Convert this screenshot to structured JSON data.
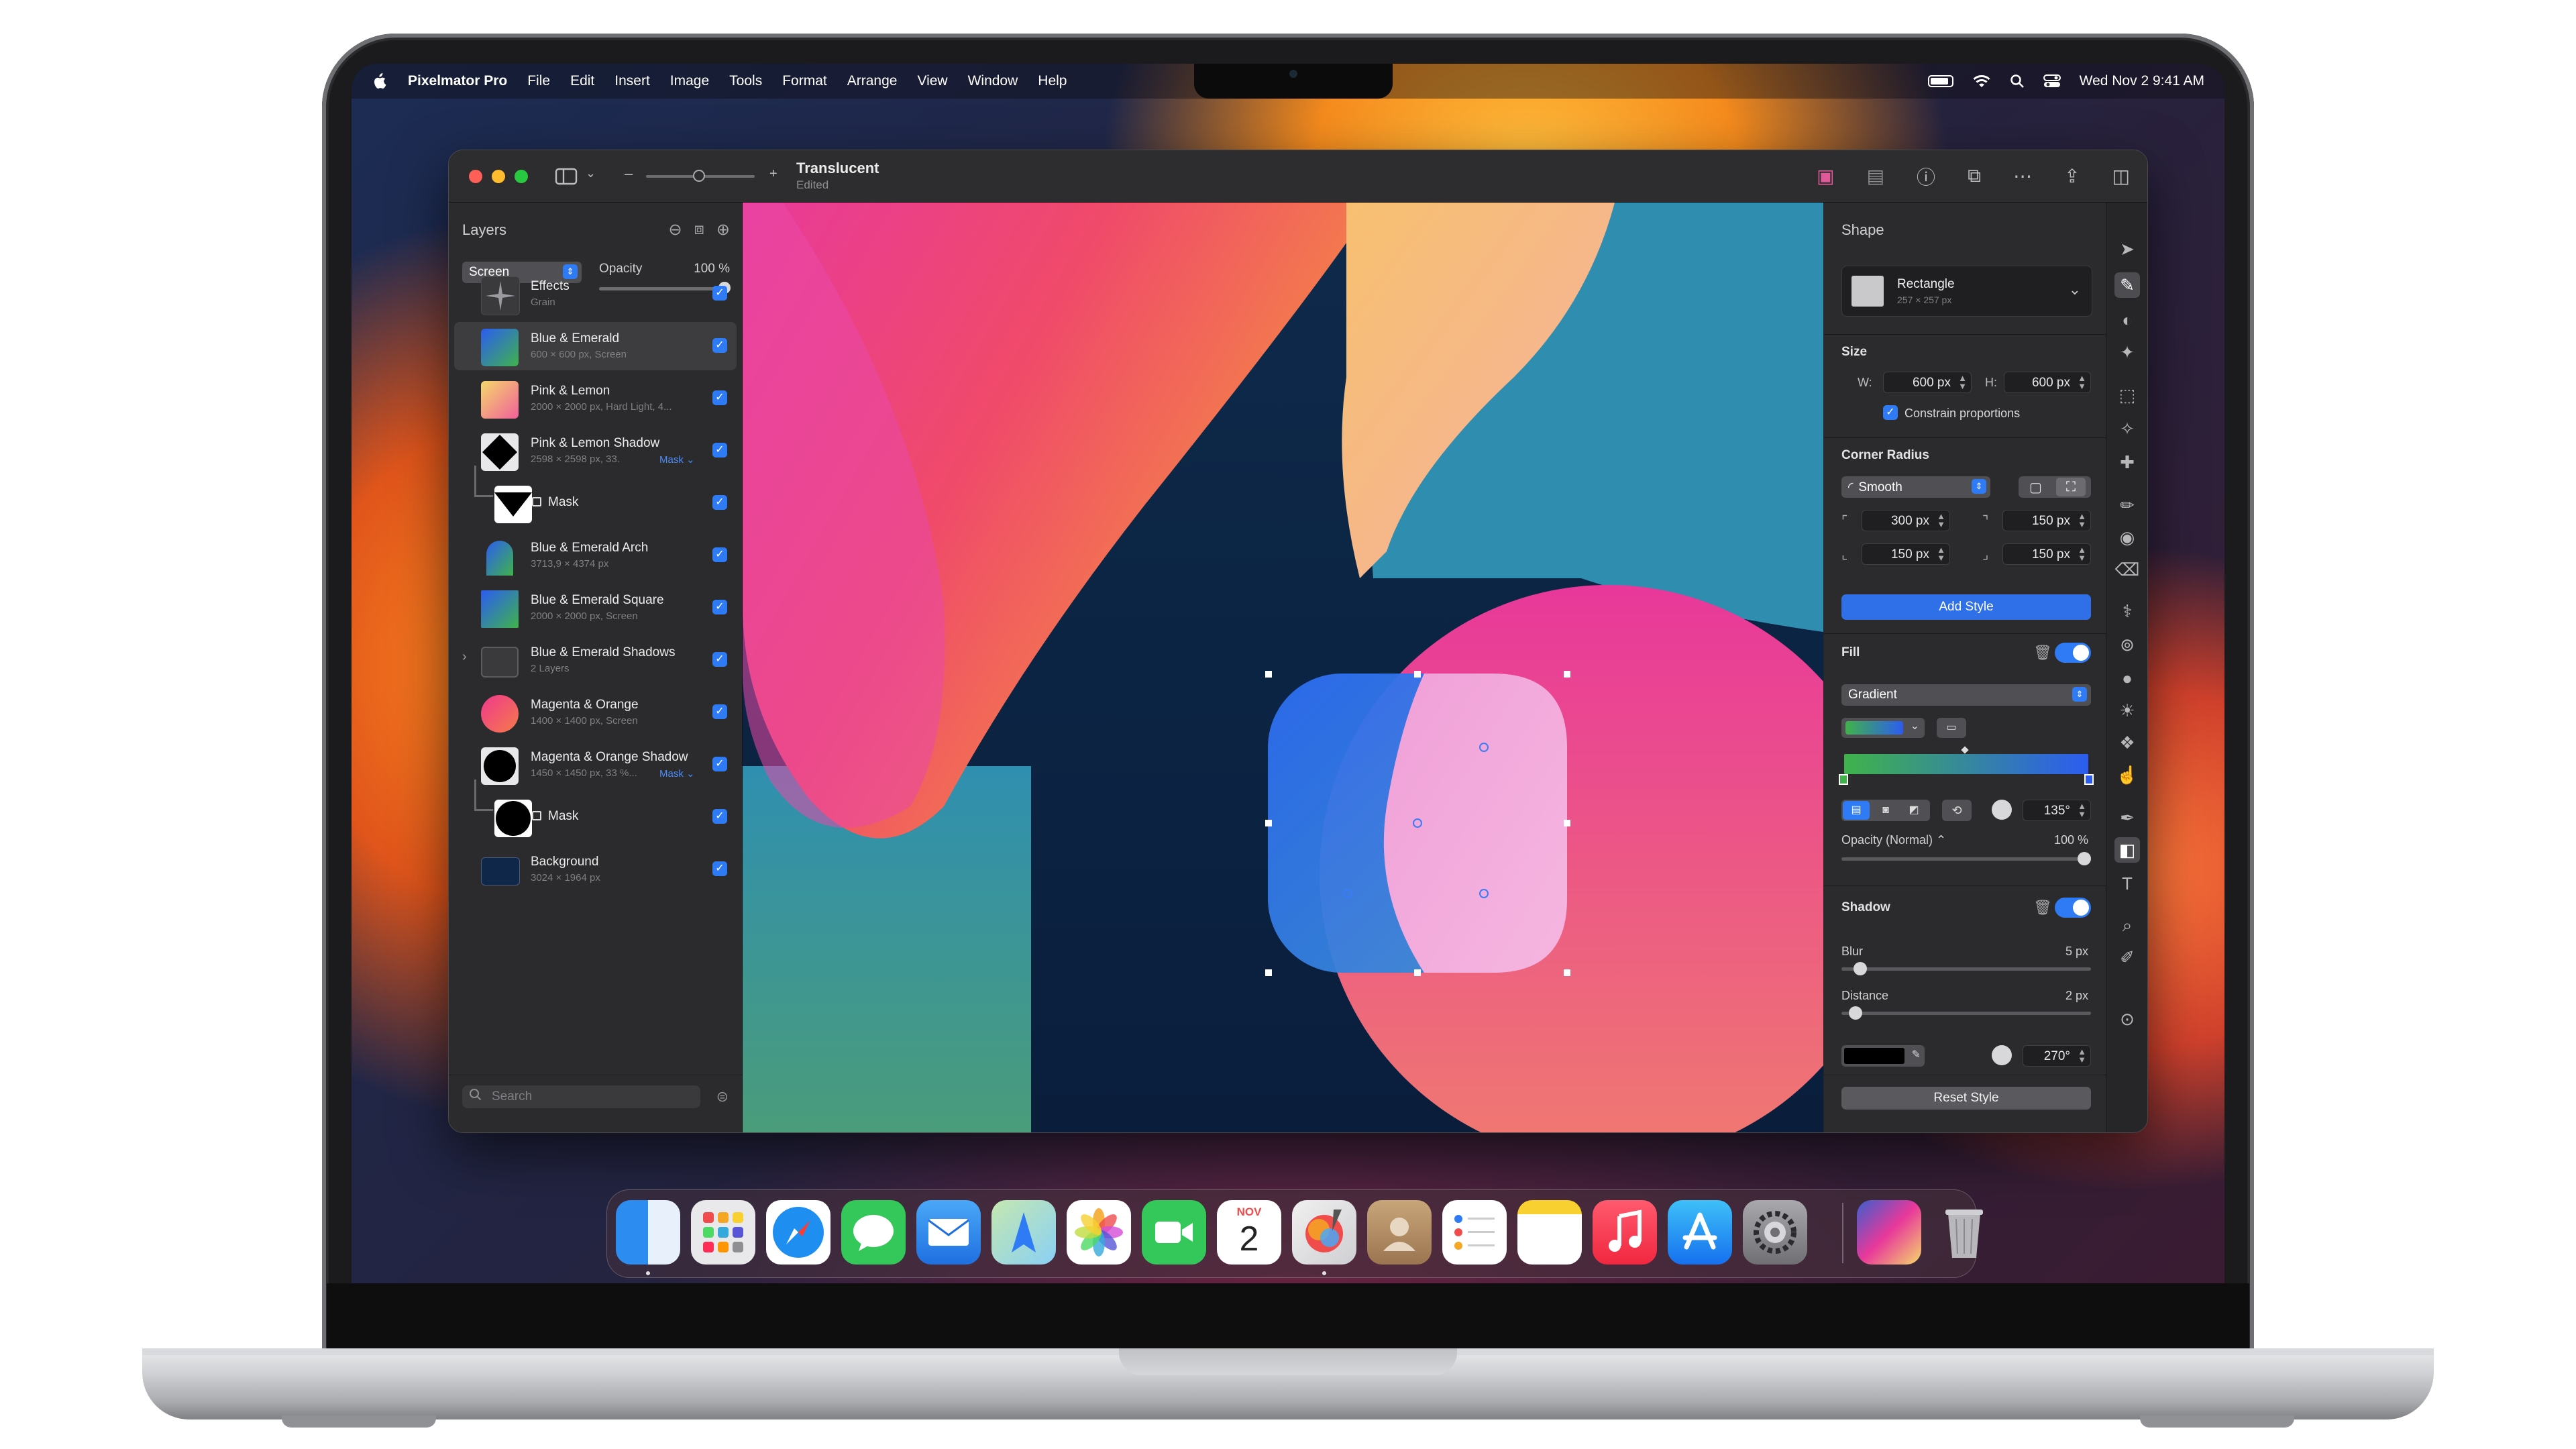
{
  "menubar": {
    "app_name": "Pixelmator Pro",
    "menus": [
      "File",
      "Edit",
      "Insert",
      "Image",
      "Tools",
      "Format",
      "Arrange",
      "View",
      "Window",
      "Help"
    ],
    "clock": "Wed Nov 2  9:41 AM"
  },
  "window": {
    "title": "Translucent",
    "subtitle": "Edited",
    "zoom_minus": "–",
    "zoom_plus": "+"
  },
  "layers_panel": {
    "title": "Layers",
    "blend_mode": "Screen",
    "opacity_label": "Opacity",
    "opacity_value": "100 %",
    "opacity_level": 1.0,
    "search_placeholder": "Search",
    "layers": [
      {
        "name": "Effects",
        "meta": "Grain"
      },
      {
        "name": "Blue & Emerald",
        "meta": "600 × 600 px, Screen"
      },
      {
        "name": "Pink & Lemon",
        "meta": "2000 × 2000 px, Hard Light, 4..."
      },
      {
        "name": "Pink & Lemon Shadow",
        "meta": "2598 × 2598 px, 33.",
        "mask_link": "Mask ⌄"
      },
      {
        "name": "Mask"
      },
      {
        "name": "Blue & Emerald Arch",
        "meta": "3713,9 × 4374 px"
      },
      {
        "name": "Blue & Emerald Square",
        "meta": "2000 × 2000 px, Screen"
      },
      {
        "name": "Blue & Emerald Shadows",
        "meta": "2 Layers"
      },
      {
        "name": "Magenta & Orange",
        "meta": "1400 × 1400 px, Screen"
      },
      {
        "name": "Magenta & Orange Shadow",
        "meta": "1450 × 1450 px, 33 %...",
        "mask_link": "Mask ⌄"
      },
      {
        "name": "Mask"
      },
      {
        "name": "Background",
        "meta": "3024 × 1964 px"
      }
    ]
  },
  "inspector": {
    "title": "Shape",
    "shape_name": "Rectangle",
    "shape_dims": "257 × 257 px",
    "size_label": "Size",
    "w_label": "W:",
    "w_value": "600 px",
    "h_label": "H:",
    "h_value": "600 px",
    "constrain_label": "Constrain proportions",
    "corner_label": "Corner Radius",
    "corner_style": "Smooth",
    "corner_tl": "300 px",
    "corner_tr": "150 px",
    "corner_bl": "150 px",
    "corner_br": "150 px",
    "add_style": "Add Style",
    "fill_label": "Fill",
    "fill_type": "Gradient",
    "gradient_angle": "135°",
    "fill_opacity_label": "Opacity (Normal) ⌃",
    "fill_opacity_value": "100 %",
    "fill_opacity_level": 1.0,
    "shadow_label": "Shadow",
    "blur_label": "Blur",
    "blur_value": "5 px",
    "blur_level": 0.05,
    "distance_label": "Distance",
    "distance_value": "2 px",
    "distance_level": 0.03,
    "shadow_angle": "270°",
    "reset_style": "Reset Style"
  },
  "colors": {
    "accent": "#2f7bf5",
    "gradient_start": "#3fb34a",
    "gradient_end": "#2c5cf0"
  },
  "icons": {
    "titlebar": [
      "sidebar-toggle-icon",
      "color-adjust-icon",
      "effects-icon",
      "info-icon",
      "crop-icon",
      "more-icon",
      "share-icon",
      "inspector-toggle-icon"
    ],
    "tools": [
      "arrange-icon",
      "style-icon",
      "color-adjust-icon",
      "effects-icon",
      "selection-icon",
      "magic-wand-icon",
      "repair-icon",
      "paint-icon",
      "fill-icon",
      "erase-icon",
      "retouch-icon",
      "clone-icon",
      "blur-icon",
      "lighten-icon",
      "sponge-icon",
      "smudge-icon",
      "pen-icon",
      "shape-icon",
      "type-icon",
      "zoom-icon",
      "eyedropper-icon",
      "more-tools-icon"
    ],
    "dock": [
      "finder-icon",
      "launchpad-icon",
      "safari-icon",
      "messages-icon",
      "mail-icon",
      "maps-icon",
      "photos-icon",
      "facetime-icon",
      "calendar-icon",
      "pixelmator-icon",
      "contacts-icon",
      "reminders-icon",
      "notes-icon",
      "music-icon",
      "app-store-icon",
      "system-settings-icon",
      "downloads-stack-icon",
      "trash-icon"
    ]
  },
  "dock": {
    "calendar_month": "NOV",
    "calendar_day": "2"
  }
}
